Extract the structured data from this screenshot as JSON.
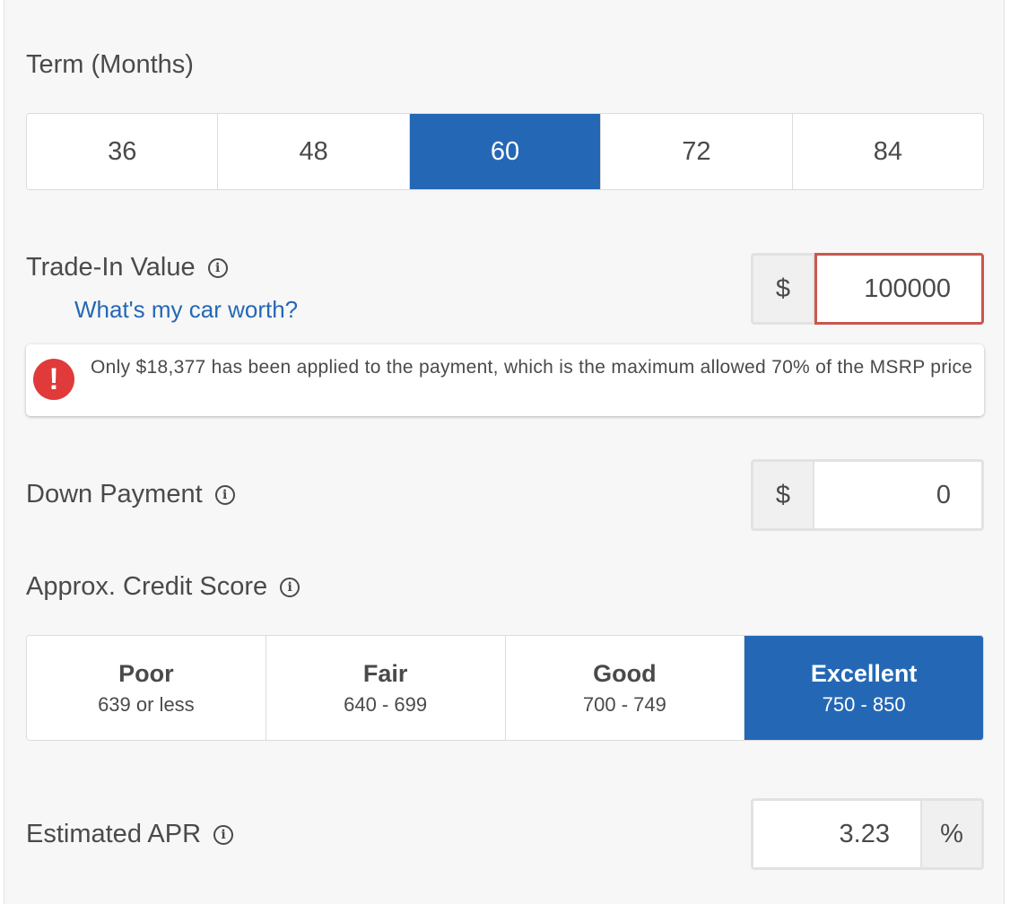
{
  "term": {
    "label": "Term (Months)",
    "options": [
      "36",
      "48",
      "60",
      "72",
      "84"
    ],
    "selected": "60"
  },
  "trade_in": {
    "label": "Trade-In Value",
    "link": "What's my car worth?",
    "currency": "$",
    "value": "100000"
  },
  "alert": {
    "message": "Only $18,377 has been applied to the payment, which is the maximum allowed 70% of the MSRP price",
    "icon": "!"
  },
  "down_payment": {
    "label": "Down Payment",
    "currency": "$",
    "value": "0"
  },
  "credit": {
    "label": "Approx. Credit Score",
    "options": [
      {
        "title": "Poor",
        "range": "639 or less"
      },
      {
        "title": "Fair",
        "range": "640 - 699"
      },
      {
        "title": "Good",
        "range": "700 - 749"
      },
      {
        "title": "Excellent",
        "range": "750 - 850"
      }
    ],
    "selected": "Excellent"
  },
  "apr": {
    "label": "Estimated APR",
    "value": "3.23",
    "unit": "%"
  },
  "info_icon_glyph": "i",
  "colors": {
    "accent": "#2468b5",
    "error_border": "#c9574d",
    "alert_icon": "#e03a3a"
  }
}
